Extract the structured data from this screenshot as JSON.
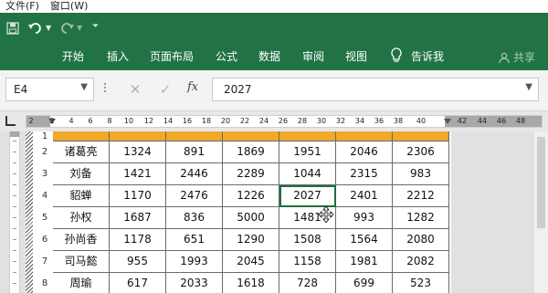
{
  "menubar": {
    "file": "文件(F)",
    "window": "窗口(W)"
  },
  "ribbon": {
    "tabs": [
      "开始",
      "插入",
      "页面布局",
      "公式",
      "数据",
      "审阅",
      "视图"
    ],
    "tell_me": "告诉我",
    "share": "共享",
    "colors": {
      "ribbon": "#217346",
      "header_fill": "#f2a829",
      "selection": "#1e6f3f"
    }
  },
  "formula_bar": {
    "name_box": "E4",
    "fx": "fx",
    "value": "2027"
  },
  "ruler": {
    "marks": [
      "2",
      "2",
      "4",
      "6",
      "8",
      "10",
      "12",
      "14",
      "16",
      "18",
      "20",
      "22",
      "24",
      "26",
      "28",
      "30",
      "32",
      "34",
      "36",
      "38",
      "40",
      "42",
      "44",
      "46",
      "48"
    ]
  },
  "table": {
    "row_numbers": [
      "1",
      "2",
      "3",
      "4",
      "5",
      "6",
      "7",
      "8"
    ],
    "rows": [
      [
        "诸葛亮",
        "1324",
        "891",
        "1869",
        "1951",
        "2046",
        "2306"
      ],
      [
        "刘备",
        "1421",
        "2446",
        "2289",
        "1044",
        "2315",
        "983"
      ],
      [
        "貂蝉",
        "1170",
        "2476",
        "1226",
        "2027",
        "2401",
        "2212"
      ],
      [
        "孙权",
        "1687",
        "836",
        "5000",
        "1481",
        "993",
        "1282"
      ],
      [
        "孙尚香",
        "1178",
        "651",
        "1290",
        "1508",
        "1564",
        "2080"
      ],
      [
        "司马懿",
        "955",
        "1993",
        "2045",
        "1158",
        "1981",
        "2082"
      ],
      [
        "周瑜",
        "617",
        "2033",
        "1618",
        "728",
        "699",
        "523"
      ]
    ]
  }
}
